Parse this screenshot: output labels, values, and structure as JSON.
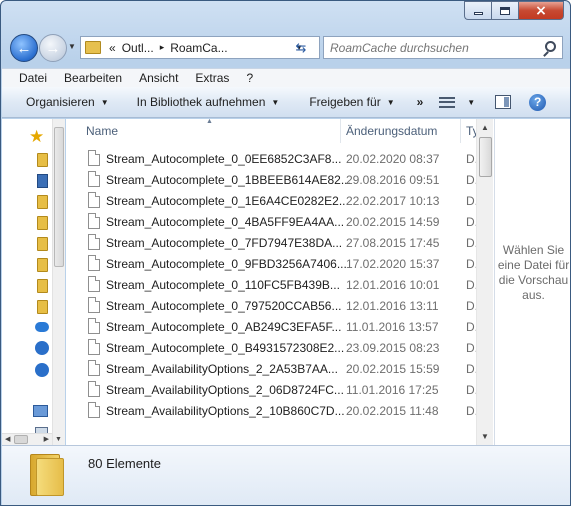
{
  "window": {
    "close_glyph": "×"
  },
  "address_bar": {
    "overflow": "«",
    "segments": [
      "Outl...",
      "RoamCa..."
    ],
    "separator": "▸"
  },
  "search": {
    "placeholder": "RoamCache durchsuchen"
  },
  "menu": [
    "Datei",
    "Bearbeiten",
    "Ansicht",
    "Extras",
    "?"
  ],
  "commands": {
    "organize": "Organisieren",
    "library": "In Bibliothek aufnehmen",
    "share": "Freigeben für",
    "more": "»"
  },
  "columns": {
    "name": "Name",
    "date": "Änderungsdatum",
    "type": "Ty"
  },
  "files": [
    {
      "name": "Stream_Autocomplete_0_0EE6852C3AF8...",
      "date": "20.02.2020 08:37",
      "type": "D."
    },
    {
      "name": "Stream_Autocomplete_0_1BBEEB614AE82...",
      "date": "29.08.2016 09:51",
      "type": "D."
    },
    {
      "name": "Stream_Autocomplete_0_1E6A4CE0282E2...",
      "date": "22.02.2017 10:13",
      "type": "D."
    },
    {
      "name": "Stream_Autocomplete_0_4BA5FF9EA4AA...",
      "date": "20.02.2015 14:59",
      "type": "D."
    },
    {
      "name": "Stream_Autocomplete_0_7FD7947E38DA...",
      "date": "27.08.2015 17:45",
      "type": "D."
    },
    {
      "name": "Stream_Autocomplete_0_9FBD3256A7406...",
      "date": "17.02.2020 15:37",
      "type": "D."
    },
    {
      "name": "Stream_Autocomplete_0_110FC5FB439B...",
      "date": "12.01.2016 10:01",
      "type": "D."
    },
    {
      "name": "Stream_Autocomplete_0_797520CCAB56...",
      "date": "12.01.2016 13:11",
      "type": "D."
    },
    {
      "name": "Stream_Autocomplete_0_AB249C3EFA5F...",
      "date": "11.01.2016 13:57",
      "type": "D."
    },
    {
      "name": "Stream_Autocomplete_0_B4931572308E2...",
      "date": "23.09.2015 08:23",
      "type": "D."
    },
    {
      "name": "Stream_AvailabilityOptions_2_2A53B7AA...",
      "date": "20.02.2015 15:59",
      "type": "D."
    },
    {
      "name": "Stream_AvailabilityOptions_2_06D8724FC...",
      "date": "11.01.2016 17:25",
      "type": "D."
    },
    {
      "name": "Stream_AvailabilityOptions_2_10B860C7D...",
      "date": "20.02.2015 11:48",
      "type": "D."
    }
  ],
  "preview": {
    "message": "Wählen Sie eine Datei für die Vorschau aus."
  },
  "details": {
    "item_count": "80 Elemente"
  },
  "colors": {
    "window_frame": "#b9d1ea",
    "close_button": "#c74a32",
    "folder": "#e7be45"
  }
}
